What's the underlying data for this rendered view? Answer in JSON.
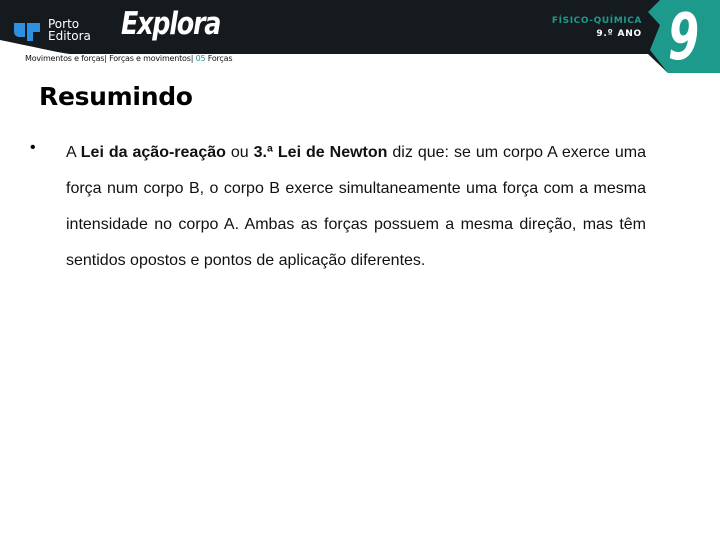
{
  "header": {
    "publisher_line1": "Porto",
    "publisher_line2": "Editora",
    "brand": "Explora",
    "subject": "FÍSICO-QUÍMICA",
    "grade": "9.º ANO",
    "grade_number": "9",
    "colors": {
      "dark": "#141a1d",
      "accent": "#1e9a8c",
      "logo_blue": "#2f8fe0"
    }
  },
  "breadcrumb": {
    "part1": "Movimentos e forças",
    "part2": "Forças e movimentos",
    "section_number": "05",
    "section": "Forças",
    "separator": "|"
  },
  "content": {
    "title": "Resumindo",
    "bullet": {
      "symbol": "•",
      "segments": [
        {
          "text": "A ",
          "bold": false
        },
        {
          "text": "Lei da ação-reação",
          "bold": true
        },
        {
          "text": " ou ",
          "bold": false
        },
        {
          "text": "3.ª Lei de Newton",
          "bold": true
        },
        {
          "text": " diz que: se um corpo A exerce uma força num corpo B, o corpo B exerce simultaneamente uma força com a mesma intensidade no corpo A. Ambas as forças possuem a mesma direção, mas têm sentidos opostos e pontos de aplicação diferentes.",
          "bold": false
        }
      ]
    }
  }
}
